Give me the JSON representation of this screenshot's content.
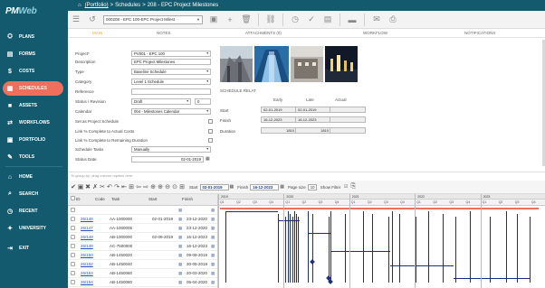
{
  "logo": {
    "text_a": "PM",
    "text_b": "Web"
  },
  "sidebar": {
    "items": [
      {
        "label": "PLANS",
        "icon": "plans-icon",
        "glyph": "⛭"
      },
      {
        "label": "FORMS",
        "icon": "forms-icon",
        "glyph": "▤"
      },
      {
        "label": "COSTS",
        "icon": "costs-icon",
        "glyph": "$"
      },
      {
        "label": "SCHEDULES",
        "icon": "schedules-icon",
        "glyph": "▦",
        "active": true
      },
      {
        "label": "ASSETS",
        "icon": "assets-icon",
        "glyph": "■"
      },
      {
        "label": "WORKFLOWS",
        "icon": "workflows-icon",
        "glyph": "⇄"
      },
      {
        "label": "PORTFOLIO",
        "icon": "portfolio-icon",
        "glyph": "▣"
      },
      {
        "label": "TOOLS",
        "icon": "tools-icon",
        "glyph": "✎"
      },
      {
        "label": "HOME",
        "icon": "home-icon",
        "glyph": "⌂"
      },
      {
        "label": "SEARCH",
        "icon": "search-icon",
        "glyph": "⌕"
      },
      {
        "label": "RECENT",
        "icon": "recent-icon",
        "glyph": "◷"
      },
      {
        "label": "UNIVERSITY",
        "icon": "university-icon",
        "glyph": "✦"
      },
      {
        "label": "EXIT",
        "icon": "exit-icon",
        "glyph": "⇥"
      }
    ]
  },
  "breadcrumb": {
    "home_glyph": "⌂",
    "portfolio": "(Portfolio)",
    "sep1": ">",
    "schedules": "Schedules",
    "sep2": ">",
    "current": "208 - EPC Project Milestones"
  },
  "toolbar": {
    "record_select": "000208 - EPC 100-EPC Project Milest"
  },
  "tabs": [
    "Main",
    "Notes",
    "Attachments (0)",
    "Workflow",
    "Notifications"
  ],
  "form": {
    "project": {
      "label": "Project*",
      "value": "PV001 - EPC 100"
    },
    "description": {
      "label": "Description",
      "value": "EPC Project Milestones"
    },
    "type": {
      "label": "Type",
      "value": "Baseline Schedule"
    },
    "category": {
      "label": "Category",
      "value": "Level 1 Schedule"
    },
    "reference": {
      "label": "Reference",
      "value": ""
    },
    "status": {
      "label": "Status / Revision",
      "value": "Draft",
      "revision": "0"
    },
    "calendar": {
      "label": "Calendar",
      "value": "004 - Milestones Calendar"
    },
    "set_as_project": {
      "label": "Set as Project Schedule"
    },
    "link_actual": {
      "label": "Link % Complete to Actual Costs"
    },
    "link_remaining": {
      "label": "Link % Complete to Remaining Duration"
    },
    "schedule_tasks": {
      "label": "Schedule Tasks",
      "value": "Manually"
    },
    "status_date": {
      "label": "Status Date",
      "value": "02-01-2019"
    }
  },
  "schedule_relationship": {
    "title": "Schedule Relat",
    "headers": [
      "Early",
      "Late",
      "Actual"
    ],
    "rows": [
      {
        "label": "Start",
        "early": "02-01-2019",
        "late": "02-01-2019",
        "actual": ""
      },
      {
        "label": "Finish",
        "early": "16-12-2023",
        "late": "16-12-2023",
        "actual": ""
      },
      {
        "label": "Duration",
        "early": "1810",
        "late": "1810",
        "actual": ""
      }
    ]
  },
  "groupbar": {
    "text": "To group by: drag column caption here"
  },
  "grid_toolbar": {
    "start_label": "Start",
    "start_value": "02-01-2019",
    "finish_label": "Finish",
    "finish_value": "16-12-2023",
    "page_size_label": "Page size",
    "page_size_value": "10",
    "show_filter_label": "Show Filter"
  },
  "grid": {
    "headers": [
      "ID",
      "Code",
      "Task",
      "Start",
      "Finish"
    ],
    "rows": [
      {
        "id": "",
        "code": "",
        "task": "",
        "start": "",
        "finish": ""
      },
      {
        "id": "26/146",
        "code": "AA-1000000",
        "task": "",
        "start": "02-01-2019",
        "finish": "23-12-2020"
      },
      {
        "id": "26/147",
        "code": "AA-1000005",
        "task": "",
        "start": "",
        "finish": "23-12-2020"
      },
      {
        "id": "26/148",
        "code": "AB-1000000",
        "task": "",
        "start": "02-09-2019",
        "finish": "16-12-2023"
      },
      {
        "id": "26/149",
        "code": "AC-7500000",
        "task": "",
        "start": "",
        "finish": "16-12-2023"
      },
      {
        "id": "26/150",
        "code": "AB-1450020",
        "task": "",
        "start": "",
        "finish": "09-09-2019"
      },
      {
        "id": "26/152",
        "code": "AB-1450040",
        "task": "",
        "start": "",
        "finish": "30-05-2019"
      },
      {
        "id": "26/153",
        "code": "AB-1450060",
        "task": "",
        "start": "",
        "finish": "20-03-2020"
      },
      {
        "id": "26/154",
        "code": "AB-1450080",
        "task": "",
        "start": "",
        "finish": "05-04-2020"
      }
    ]
  },
  "gantt": {
    "years": [
      "2019",
      "2020",
      "2021",
      "2022",
      "2023"
    ],
    "quarter_labels": [
      "Q1",
      "Q2",
      "Q3",
      "Q4",
      "Q1",
      "Q2",
      "Q3",
      "Q4",
      "Q1",
      "Q2",
      "Q3",
      "Q4",
      "Q1",
      "Q2",
      "Q3",
      "Q4",
      "Q1",
      "Q2",
      "Q3",
      "Q4"
    ],
    "bar_color": "#1a2e7a",
    "accent_color": "#f06e5c"
  }
}
